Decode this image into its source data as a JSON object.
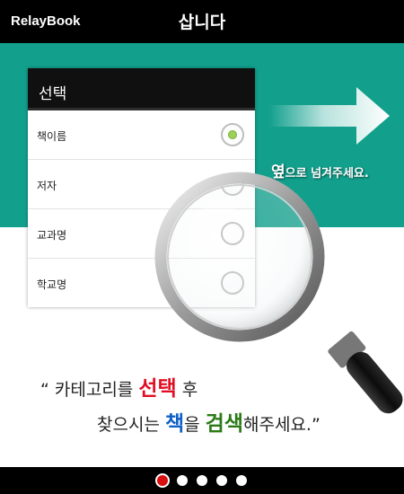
{
  "header": {
    "brand": "RelayBook",
    "title": "삽니다"
  },
  "category_panel": {
    "title": "선택",
    "options": [
      {
        "label": "책이름",
        "selected": true
      },
      {
        "label": "저자",
        "selected": false
      },
      {
        "label": "교과명",
        "selected": false
      },
      {
        "label": "학교명",
        "selected": false
      }
    ]
  },
  "swipe_hint": {
    "lead": "옆",
    "rest": "으로 넘겨주세요."
  },
  "instruction": {
    "line1_open": "“ 카테고리를 ",
    "line1_emph": "선택",
    "line1_close": " 후",
    "line2_a": "찾으시는 ",
    "line2_emph1": "책",
    "line2_b": "을 ",
    "line2_emph2": "검색",
    "line2_c": "해주세요.”"
  },
  "pagination": {
    "total": 5,
    "active_index": 0
  },
  "colors": {
    "teal": "#12a08d",
    "accent_red": "#e00f24",
    "accent_blue": "#1060c8",
    "accent_green": "#2b7a17",
    "radio_on": "#9bd05a"
  },
  "icons": [
    "right-arrow-icon",
    "magnifying-glass-icon",
    "radio-icon"
  ]
}
